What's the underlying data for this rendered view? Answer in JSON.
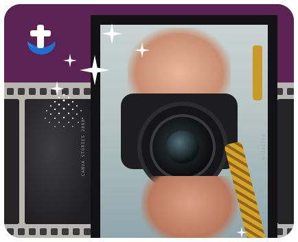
{
  "thumbnail": {
    "film_text_left": "CANVA STORIES 2860",
    "film_text_right": "FUJIFILM",
    "colors": {
      "brand_purple": "#5b2354",
      "film_grey": "#b9b6b1",
      "frame_black": "#121214",
      "logo_blue": "#1d6fd1"
    },
    "icons": {
      "logo": "cross-hand-logo-icon",
      "sparkles": "sparkle-icon",
      "dots": "starburst-dots-icon"
    }
  }
}
